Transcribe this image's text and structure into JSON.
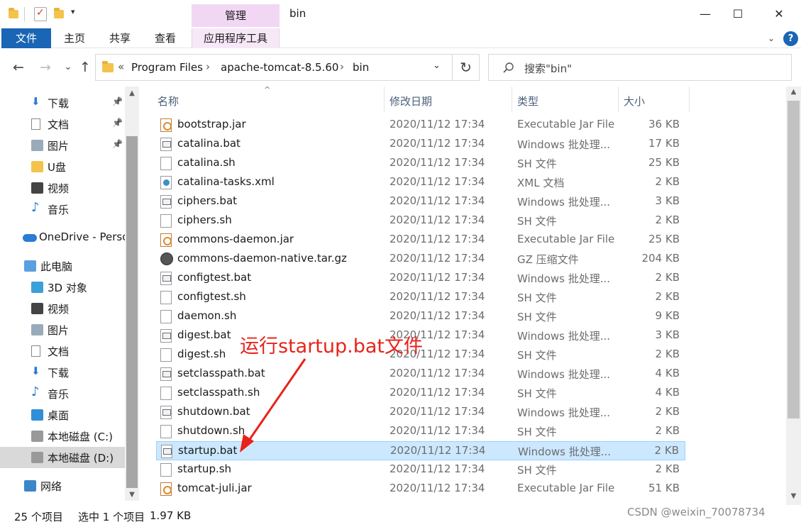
{
  "titlebar": {
    "context_tab": "管理",
    "title": "bin",
    "minimize": "—",
    "maximize": "☐",
    "close": "✕"
  },
  "ribbon": {
    "tabs": [
      {
        "label": "文件"
      },
      {
        "label": "主页"
      },
      {
        "label": "共享"
      },
      {
        "label": "查看"
      },
      {
        "label": "应用程序工具"
      }
    ],
    "expand": "⌄",
    "help": "?"
  },
  "address": {
    "overflow": "«",
    "crumbs": [
      "Program Files",
      "apache-tomcat-8.5.60",
      "bin"
    ],
    "separator": "›",
    "search_placeholder": "搜索\"bin\""
  },
  "nav": {
    "back": "←",
    "forward": "→",
    "recent": "⌄",
    "up": "↑",
    "refresh": "↻",
    "dropdown": "⌄"
  },
  "sidebar": {
    "items": [
      {
        "label": "下载",
        "icon": "download-arrow-icon",
        "pinned": true
      },
      {
        "label": "文档",
        "icon": "document-icon",
        "pinned": true
      },
      {
        "label": "图片",
        "icon": "picture-icon",
        "pinned": true
      },
      {
        "label": "U盘",
        "icon": "folder-icon",
        "pinned": false
      },
      {
        "label": "视频",
        "icon": "video-icon",
        "pinned": false
      },
      {
        "label": "音乐",
        "icon": "music-note-icon",
        "pinned": false
      },
      {
        "label": "OneDrive - Perso",
        "icon": "cloud-icon",
        "pinned": false
      },
      {
        "label": "此电脑",
        "icon": "computer-icon",
        "pinned": false
      },
      {
        "label": "3D 对象",
        "icon": "cube-icon",
        "pinned": false
      },
      {
        "label": "视频",
        "icon": "video-icon",
        "pinned": false
      },
      {
        "label": "图片",
        "icon": "picture-icon",
        "pinned": false
      },
      {
        "label": "文档",
        "icon": "document-icon",
        "pinned": false
      },
      {
        "label": "下载",
        "icon": "download-arrow-icon",
        "pinned": false
      },
      {
        "label": "音乐",
        "icon": "music-note-icon",
        "pinned": false
      },
      {
        "label": "桌面",
        "icon": "desktop-icon",
        "pinned": false
      },
      {
        "label": "本地磁盘 (C:)",
        "icon": "drive-c-icon",
        "pinned": false
      },
      {
        "label": "本地磁盘 (D:)",
        "icon": "drive-icon",
        "pinned": false,
        "selected": true
      },
      {
        "label": "网络",
        "icon": "network-icon",
        "pinned": false
      }
    ]
  },
  "columns": {
    "name": "名称",
    "date": "修改日期",
    "type": "类型",
    "size": "大小"
  },
  "files": [
    {
      "name": "bootstrap.jar",
      "date": "2020/11/12 17:34",
      "type": "Executable Jar File",
      "size": "36 KB",
      "kind": "jar"
    },
    {
      "name": "catalina.bat",
      "date": "2020/11/12 17:34",
      "type": "Windows 批处理...",
      "size": "17 KB",
      "kind": "bat"
    },
    {
      "name": "catalina.sh",
      "date": "2020/11/12 17:34",
      "type": "SH 文件",
      "size": "25 KB",
      "kind": "sh"
    },
    {
      "name": "catalina-tasks.xml",
      "date": "2020/11/12 17:34",
      "type": "XML 文档",
      "size": "2 KB",
      "kind": "xml"
    },
    {
      "name": "ciphers.bat",
      "date": "2020/11/12 17:34",
      "type": "Windows 批处理...",
      "size": "3 KB",
      "kind": "bat"
    },
    {
      "name": "ciphers.sh",
      "date": "2020/11/12 17:34",
      "type": "SH 文件",
      "size": "2 KB",
      "kind": "sh"
    },
    {
      "name": "commons-daemon.jar",
      "date": "2020/11/12 17:34",
      "type": "Executable Jar File",
      "size": "25 KB",
      "kind": "jar"
    },
    {
      "name": "commons-daemon-native.tar.gz",
      "date": "2020/11/12 17:34",
      "type": "GZ 压缩文件",
      "size": "204 KB",
      "kind": "gz"
    },
    {
      "name": "configtest.bat",
      "date": "2020/11/12 17:34",
      "type": "Windows 批处理...",
      "size": "2 KB",
      "kind": "bat"
    },
    {
      "name": "configtest.sh",
      "date": "2020/11/12 17:34",
      "type": "SH 文件",
      "size": "2 KB",
      "kind": "sh"
    },
    {
      "name": "daemon.sh",
      "date": "2020/11/12 17:34",
      "type": "SH 文件",
      "size": "9 KB",
      "kind": "sh"
    },
    {
      "name": "digest.bat",
      "date": "2020/11/12 17:34",
      "type": "Windows 批处理...",
      "size": "3 KB",
      "kind": "bat"
    },
    {
      "name": "digest.sh",
      "date": "2020/11/12 17:34",
      "type": "SH 文件",
      "size": "2 KB",
      "kind": "sh"
    },
    {
      "name": "setclasspath.bat",
      "date": "2020/11/12 17:34",
      "type": "Windows 批处理...",
      "size": "4 KB",
      "kind": "bat"
    },
    {
      "name": "setclasspath.sh",
      "date": "2020/11/12 17:34",
      "type": "SH 文件",
      "size": "4 KB",
      "kind": "sh"
    },
    {
      "name": "shutdown.bat",
      "date": "2020/11/12 17:34",
      "type": "Windows 批处理...",
      "size": "2 KB",
      "kind": "bat"
    },
    {
      "name": "shutdown.sh",
      "date": "2020/11/12 17:34",
      "type": "SH 文件",
      "size": "2 KB",
      "kind": "sh"
    },
    {
      "name": "startup.bat",
      "date": "2020/11/12 17:34",
      "type": "Windows 批处理...",
      "size": "2 KB",
      "kind": "bat",
      "selected": true
    },
    {
      "name": "startup.sh",
      "date": "2020/11/12 17:34",
      "type": "SH 文件",
      "size": "2 KB",
      "kind": "sh"
    },
    {
      "name": "tomcat-juli.jar",
      "date": "2020/11/12 17:34",
      "type": "Executable Jar File",
      "size": "51 KB",
      "kind": "jar"
    }
  ],
  "status": {
    "item_count": "25 个项目",
    "selection": "选中 1 个项目",
    "selection_size": "1.97 KB"
  },
  "annotation": {
    "text": "运行startup.bat文件",
    "color": "#e8221b"
  },
  "watermark": "CSDN @weixin_70078734",
  "colors": {
    "accent": "#1a65b5",
    "context_tab": "#f2d7f4",
    "selection": "#cce8ff"
  }
}
